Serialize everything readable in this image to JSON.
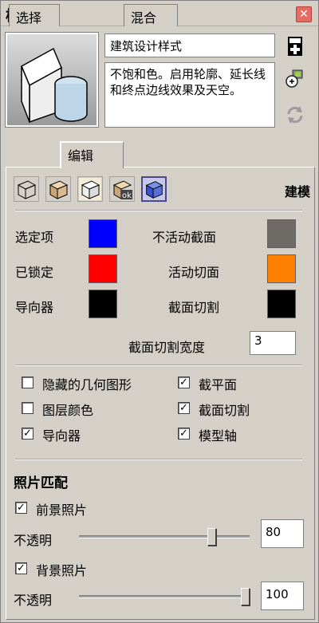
{
  "window": {
    "title": "样式",
    "close_icon": "close-icon"
  },
  "style": {
    "name": "建筑设计样式",
    "description": "不饱和色。启用轮廓、延长线和终点边线效果及天空。"
  },
  "tabs": [
    {
      "label": "选择"
    },
    {
      "label": "编辑",
      "active": true
    },
    {
      "label": "混合"
    }
  ],
  "edit_modes": {
    "icons": [
      "edge-settings-icon",
      "face-settings-icon",
      "background-settings-icon",
      "watermark-settings-icon",
      "modeling-settings-icon"
    ],
    "current_label": "建模"
  },
  "colors": {
    "selected": {
      "label": "选定项",
      "hex": "#0000ff"
    },
    "locked": {
      "label": "已锁定",
      "hex": "#ff0000"
    },
    "guides": {
      "label": "导向器",
      "hex": "#000000"
    },
    "inactive_section": {
      "label": "不活动截面",
      "hex": "#6e6a66"
    },
    "active_section": {
      "label": "活动切面",
      "hex": "#ff8000"
    },
    "section_cuts": {
      "label": "截面切割",
      "hex": "#000000"
    }
  },
  "section_cut_width": {
    "label": "截面切割宽度",
    "value": "3"
  },
  "checkboxes": {
    "hidden_geometry": {
      "label": "隐藏的几何图形",
      "checked": false
    },
    "layer_colors": {
      "label": "图层颜色",
      "checked": false
    },
    "guides": {
      "label": "导向器",
      "checked": true
    },
    "section_planes": {
      "label": "截平面",
      "checked": true
    },
    "section_cuts": {
      "label": "截面切割",
      "checked": true
    },
    "model_axes": {
      "label": "模型轴",
      "checked": true
    }
  },
  "photo_match": {
    "title": "照片匹配",
    "foreground": {
      "label": "前景照片",
      "checked": true,
      "opacity_label": "不透明",
      "opacity": "80"
    },
    "background": {
      "label": "背景照片",
      "checked": true,
      "opacity_label": "不透明",
      "opacity": "100"
    }
  }
}
